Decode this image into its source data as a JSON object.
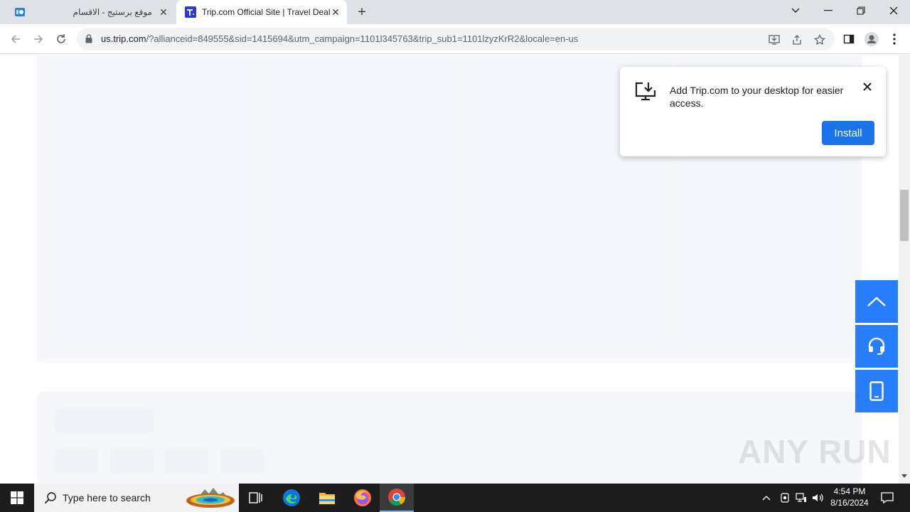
{
  "browser": {
    "tabs": [
      {
        "title": "موقع برستيج - الاقسام",
        "active": false
      },
      {
        "title": "Trip.com Official Site | Travel Deals",
        "active": true
      }
    ],
    "new_tab_label": "+",
    "url_host": "us.trip.com",
    "url_path": "/?allianceid=849555&sid=1415694&utm_campaign=1101l345763&trip_sub1=1101lzyzKrR2&locale=en-us"
  },
  "popup": {
    "message": "Add Trip.com to your desktop for easier access.",
    "install_label": "Install"
  },
  "watermark": "ANY RUN",
  "taskbar": {
    "search_placeholder": "Type here to search",
    "time": "4:54 PM",
    "date": "8/16/2024"
  },
  "colors": {
    "accent": "#287dfa",
    "install_button": "#1a73e8",
    "skeleton": "#f3f6fb"
  }
}
